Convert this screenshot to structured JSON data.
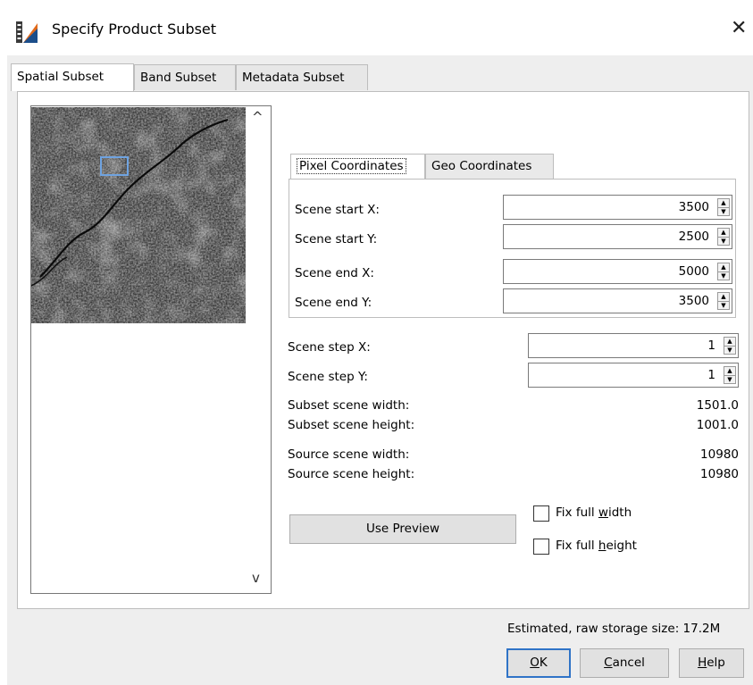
{
  "window": {
    "title": "Specify Product Subset",
    "close_symbol": "✕"
  },
  "tabs": [
    {
      "label": "Spatial Subset",
      "active": true
    },
    {
      "label": "Band Subset",
      "active": false
    },
    {
      "label": "Metadata Subset",
      "active": false
    }
  ],
  "preview": {
    "scroll_up": "^",
    "scroll_down": "v"
  },
  "coord_tabs": [
    {
      "label": "Pixel Coordinates",
      "active": true
    },
    {
      "label": "Geo Coordinates",
      "active": false
    }
  ],
  "pixel_coordinates": {
    "scene_start_x": {
      "label": "Scene start X:",
      "value": "3500"
    },
    "scene_start_y": {
      "label": "Scene start Y:",
      "value": "2500"
    },
    "scene_end_x": {
      "label": "Scene end X:",
      "value": "5000"
    },
    "scene_end_y": {
      "label": "Scene end Y:",
      "value": "3500"
    }
  },
  "step": {
    "scene_step_x": {
      "label": "Scene step X:",
      "value": "1"
    },
    "scene_step_y": {
      "label": "Scene step Y:",
      "value": "1"
    }
  },
  "info": {
    "subset_width": {
      "label": "Subset scene width:",
      "value": "1501.0"
    },
    "subset_height": {
      "label": "Subset scene height:",
      "value": "1001.0"
    },
    "source_width": {
      "label": "Source scene width:",
      "value": "10980"
    },
    "source_height": {
      "label": "Source scene height:",
      "value": "10980"
    }
  },
  "use_preview_label": "Use Preview",
  "fix_full_width": {
    "pre": "Fix full ",
    "mnemonic": "w",
    "post": "idth",
    "checked": false
  },
  "fix_full_height": {
    "pre": "Fix full ",
    "mnemonic": "h",
    "post": "eight",
    "checked": false
  },
  "storage_text": "Estimated, raw storage size: 17.2M",
  "buttons": {
    "ok": {
      "mnemonic": "O",
      "rest": "K"
    },
    "cancel": {
      "mnemonic": "C",
      "rest": "ancel"
    },
    "help": {
      "mnemonic": "H",
      "rest": "elp"
    }
  },
  "colors": {
    "accent": "#2f73c7",
    "panel_bg": "#eeeeee",
    "selection_box": "#6fa3e0"
  },
  "icons": {
    "app": "snap-app-icon",
    "close": "close-icon",
    "spin_up": "arrow-up-icon",
    "spin_down": "arrow-down-icon"
  }
}
